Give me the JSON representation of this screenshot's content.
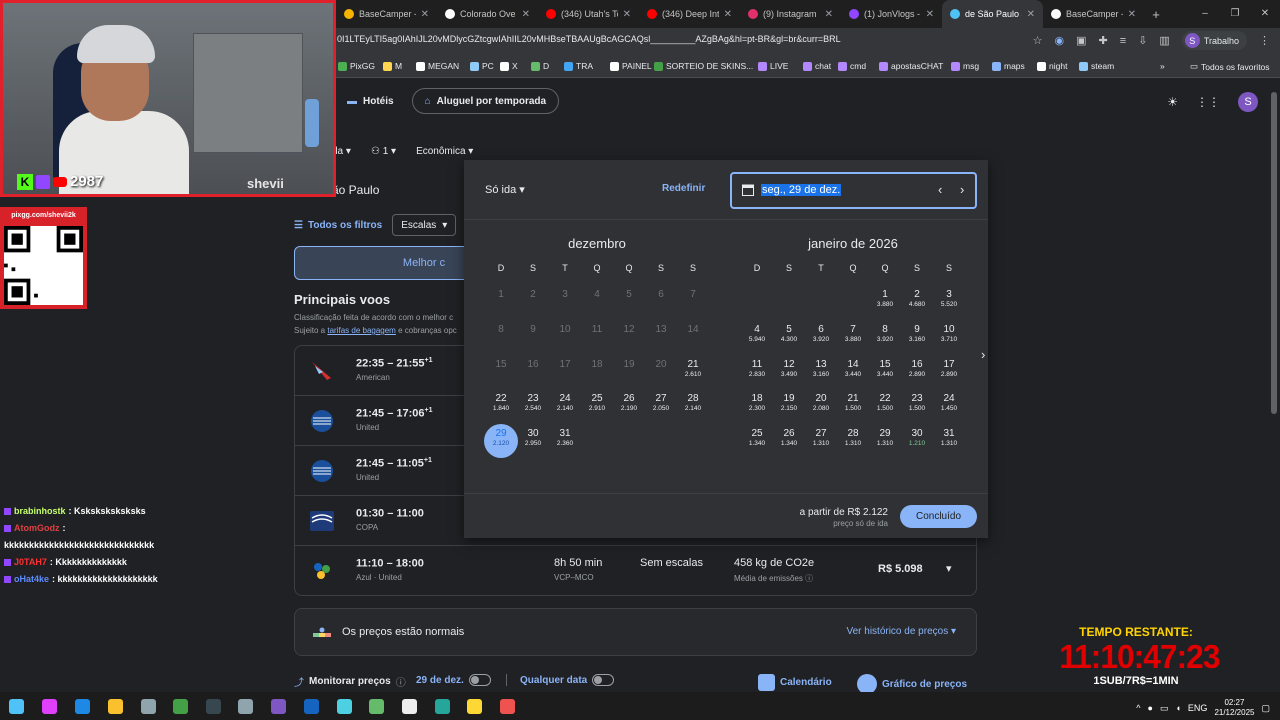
{
  "browser": {
    "tabs": [
      {
        "label": "BaseCamper -",
        "color": "#f4b400"
      },
      {
        "label": "Colorado Ove",
        "color": "#ffffff"
      },
      {
        "label": "(346) Utah's To",
        "color": "#ff0000"
      },
      {
        "label": "(346) Deep Int",
        "color": "#ff0000"
      },
      {
        "label": "(9) Instagram",
        "color": "#e1306c"
      },
      {
        "label": "(1) JonVlogs -",
        "color": "#9146ff"
      },
      {
        "label": "de São Paulo a",
        "color": "#4fc3f7",
        "active": true
      },
      {
        "label": "BaseCamper -",
        "color": "#ffffff"
      }
    ],
    "url": "0I1LTEyLTI5ag0IAhIJL20vMDlycGZtcgwIAhIIL20vMHBseTBAAUgBcAGCAQsl_________AZgBAg&hl=pt-BR&gl=br&curr=BRL",
    "profile_label": "Trabalho",
    "profile_initial": "S",
    "bookmarks": [
      "PixGG",
      "M",
      "MEGAN",
      "PC",
      "X",
      "D",
      "TRA",
      "PAINEL",
      "SORTEIO DE SKINS...",
      "LIVE",
      "chat",
      "cmd",
      "apostasCHAT",
      "msg",
      "maps",
      "night",
      "steam"
    ],
    "all_favorites": "Todos os favoritos"
  },
  "app": {
    "nav": {
      "hotels": "Hotéis",
      "rentals": "Aluguel por temporada"
    },
    "options": {
      "trip": "da",
      "passengers": "1",
      "class": "Econômica"
    },
    "origin": "ão Paulo",
    "filters": {
      "all_filters": "Todos os filtros",
      "stops": "Escalas"
    },
    "best_tab": "Melhor c",
    "section_title": "Principais voos",
    "section_sub1": "Classificação feita de acordo com o melhor c",
    "section_sub2_pre": "Sujeito a ",
    "section_sub2_link": "tarifas de bagagem",
    "section_sub2_post": " e cobranças opc",
    "flights": [
      {
        "time": "22:35 – 21:55",
        "plus": "+1",
        "airline": "American",
        "logo": "american"
      },
      {
        "time": "21:45 – 17:06",
        "plus": "+1",
        "airline": "United",
        "logo": "united"
      },
      {
        "time": "21:45 – 11:05",
        "plus": "+1",
        "airline": "United",
        "logo": "united"
      },
      {
        "time": "01:30 – 11:00",
        "plus": "",
        "airline": "COPA",
        "logo": "copa"
      },
      {
        "time": "11:10 – 18:00",
        "plus": "",
        "airline": "Azul · United",
        "logo": "azul",
        "duration": "8h 50 min",
        "route": "VCP–MCO",
        "stops": "Sem escalas",
        "co2": "458 kg de CO2e",
        "emissions": "Média de emissões",
        "price": "R$ 5.098"
      }
    ],
    "price_banner": {
      "text": "Os preços estão normais",
      "link": "Ver histórico de preços"
    },
    "bottom": {
      "track": "Monitorar preços",
      "date": "29 de dez.",
      "any_date": "Qualquer data",
      "calendar": "Calendário",
      "price_graph": "Gráfico de preços"
    }
  },
  "picker": {
    "trip_type": "Só ida",
    "reset": "Redefinir",
    "date_value": "seg., 29 de dez.",
    "weekdays": [
      "D",
      "S",
      "T",
      "Q",
      "Q",
      "S",
      "S"
    ],
    "months": [
      {
        "name": "dezembro",
        "offset": 0,
        "days": [
          {
            "n": "1",
            "past": true
          },
          {
            "n": "2",
            "past": true
          },
          {
            "n": "3",
            "past": true
          },
          {
            "n": "4",
            "past": true
          },
          {
            "n": "5",
            "past": true
          },
          {
            "n": "6",
            "past": true
          },
          {
            "n": "7",
            "past": true
          },
          {
            "n": "8",
            "past": true
          },
          {
            "n": "9",
            "past": true
          },
          {
            "n": "10",
            "past": true
          },
          {
            "n": "11",
            "past": true
          },
          {
            "n": "12",
            "past": true
          },
          {
            "n": "13",
            "past": true
          },
          {
            "n": "14",
            "past": true
          },
          {
            "n": "15",
            "past": true
          },
          {
            "n": "16",
            "past": true
          },
          {
            "n": "17",
            "past": true
          },
          {
            "n": "18",
            "past": true
          },
          {
            "n": "19",
            "past": true
          },
          {
            "n": "20",
            "past": true
          },
          {
            "n": "21",
            "p": "2.610"
          },
          {
            "n": "22",
            "p": "1.840"
          },
          {
            "n": "23",
            "p": "2.540"
          },
          {
            "n": "24",
            "p": "2.140"
          },
          {
            "n": "25",
            "p": "2.910"
          },
          {
            "n": "26",
            "p": "2.190"
          },
          {
            "n": "27",
            "p": "2.050"
          },
          {
            "n": "28",
            "p": "2.140"
          },
          {
            "n": "29",
            "p": "2.120",
            "sel": true
          },
          {
            "n": "30",
            "p": "2.950"
          },
          {
            "n": "31",
            "p": "2.360"
          }
        ]
      },
      {
        "name": "janeiro de 2026",
        "offset": 4,
        "days": [
          {
            "n": "1",
            "p": "3.880"
          },
          {
            "n": "2",
            "p": "4.680"
          },
          {
            "n": "3",
            "p": "5.520"
          },
          {
            "n": "4",
            "p": "5.940"
          },
          {
            "n": "5",
            "p": "4.300"
          },
          {
            "n": "6",
            "p": "3.920"
          },
          {
            "n": "7",
            "p": "3.880"
          },
          {
            "n": "8",
            "p": "3.920"
          },
          {
            "n": "9",
            "p": "3.160"
          },
          {
            "n": "10",
            "p": "3.710"
          },
          {
            "n": "11",
            "p": "2.830"
          },
          {
            "n": "12",
            "p": "3.490"
          },
          {
            "n": "13",
            "p": "3.160"
          },
          {
            "n": "14",
            "p": "3.440"
          },
          {
            "n": "15",
            "p": "3.440"
          },
          {
            "n": "16",
            "p": "2.890"
          },
          {
            "n": "17",
            "p": "2.890"
          },
          {
            "n": "18",
            "p": "2.300"
          },
          {
            "n": "19",
            "p": "2.150"
          },
          {
            "n": "20",
            "p": "2.080"
          },
          {
            "n": "21",
            "p": "1.500"
          },
          {
            "n": "22",
            "p": "1.500"
          },
          {
            "n": "23",
            "p": "1.500"
          },
          {
            "n": "24",
            "p": "1.450"
          },
          {
            "n": "25",
            "p": "1.340"
          },
          {
            "n": "26",
            "p": "1.340"
          },
          {
            "n": "27",
            "p": "1.310"
          },
          {
            "n": "28",
            "p": "1.310"
          },
          {
            "n": "29",
            "p": "1.310"
          },
          {
            "n": "30",
            "p": "1.210",
            "low": true
          },
          {
            "n": "31",
            "p": "1.310"
          }
        ]
      }
    ],
    "from_price": "a partir de R$ 2.122",
    "from_sub": "preço só de ida",
    "done": "Concluído"
  },
  "stream": {
    "sub_count": "2987",
    "cam_name": "shevii",
    "qr_url": "pixgg.com/shevii2k",
    "chat": [
      {
        "user": "brabinhostk",
        "color": "#c6ff6b",
        "msg": ": Ksksksksksksks"
      },
      {
        "user": "AtomGodz",
        "color": "#e04040",
        "msg": ":"
      },
      {
        "user": "",
        "color": "#ffffff",
        "msg": "kkkkkkkkkkkkkkkkkkkkkkkkkkkkkk"
      },
      {
        "user": "J0TAH7",
        "color": "#ff3030",
        "msg": ": Kkkkkkkkkkkkkk"
      },
      {
        "user": "oHat4ke",
        "color": "#5b8cff",
        "msg": ": kkkkkkkkkkkkkkkkkkkk"
      }
    ],
    "timer_label": "TEMPO RESTANTE:",
    "timer": "11:10:47:23",
    "timer_sub": "1SUB/7R$=1MIN"
  },
  "taskbar": {
    "lang": "ENG",
    "time": "02:27",
    "date": "21/12/2025"
  }
}
